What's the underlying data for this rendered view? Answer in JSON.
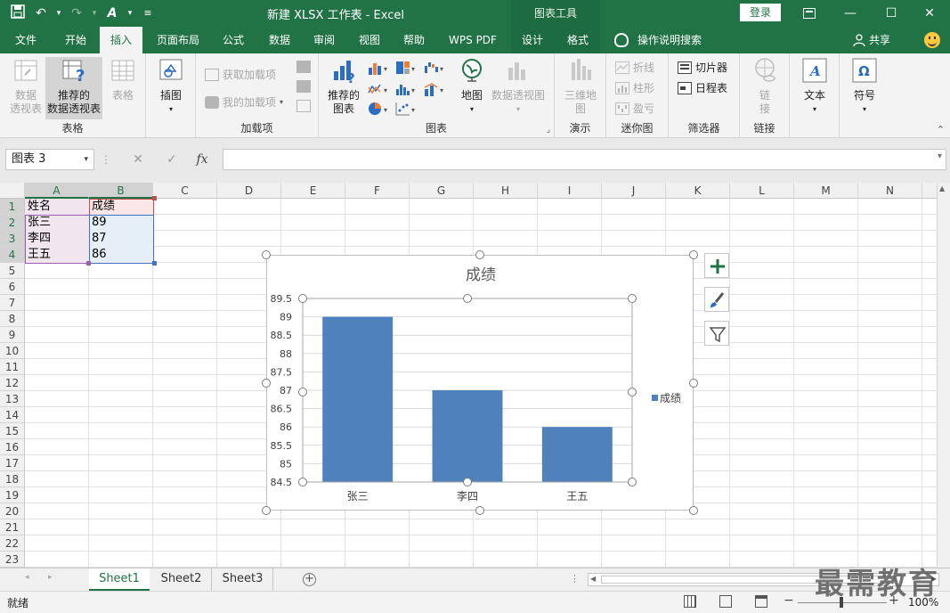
{
  "titlebar": {
    "title": "新建 XLSX 工作表  -  Excel",
    "context_label": "图表工具",
    "login": "登录"
  },
  "tabs": [
    {
      "label": "文件",
      "active": false
    },
    {
      "label": "开始",
      "active": false
    },
    {
      "label": "插入",
      "active": true
    },
    {
      "label": "页面布局",
      "active": false
    },
    {
      "label": "公式",
      "active": false
    },
    {
      "label": "数据",
      "active": false
    },
    {
      "label": "审阅",
      "active": false
    },
    {
      "label": "视图",
      "active": false
    },
    {
      "label": "帮助",
      "active": false
    },
    {
      "label": "WPS PDF",
      "active": false
    },
    {
      "label": "设计",
      "active": false
    },
    {
      "label": "格式",
      "active": false
    }
  ],
  "tell_me": "操作说明搜索",
  "share": "共享",
  "ribbon": {
    "tables": {
      "label": "表格",
      "pivot": "数据\n透视表",
      "recommended_pivot": "推荐的\n数据透视表",
      "table": "表格"
    },
    "illustrations": {
      "insert_picture": "插图"
    },
    "addins": {
      "label": "加载项",
      "get": "获取加载项",
      "my": "我的加载项"
    },
    "charts": {
      "label": "图表",
      "recommended": "推荐的\n图表",
      "map": "地图",
      "pivot_chart": "数据透视图"
    },
    "tours": {
      "label": "演示",
      "map3d": "三维地\n图"
    },
    "sparklines": {
      "label": "迷你图",
      "line": "折线",
      "column": "柱形",
      "winloss": "盈亏"
    },
    "filters": {
      "label": "筛选器",
      "slicer": "切片器",
      "timeline": "日程表"
    },
    "links": {
      "label": "链接",
      "link": "链\n接"
    },
    "text": {
      "label": "文本"
    },
    "symbols": {
      "label": "符号"
    }
  },
  "formula_bar": {
    "name_box": "图表 3",
    "fx": "fx",
    "value": ""
  },
  "columns": [
    "A",
    "B",
    "C",
    "D",
    "E",
    "F",
    "G",
    "H",
    "I",
    "J",
    "K",
    "L",
    "M",
    "N"
  ],
  "rows": [
    "1",
    "2",
    "3",
    "4",
    "5",
    "6",
    "7",
    "8",
    "9",
    "10",
    "11",
    "12",
    "13",
    "14",
    "15",
    "16",
    "17",
    "18",
    "19",
    "20",
    "21",
    "22",
    "23"
  ],
  "cells": {
    "A1": "姓名",
    "B1": "成绩",
    "A2": "张三",
    "B2": "89",
    "A3": "李四",
    "B3": "87",
    "A4": "王五",
    "B4": "86"
  },
  "chart_data": {
    "type": "bar",
    "title": "成绩",
    "categories": [
      "张三",
      "李四",
      "王五"
    ],
    "series": [
      {
        "name": "成绩",
        "values": [
          89,
          87,
          86
        ],
        "color": "#4f81bd"
      }
    ],
    "ylim": [
      84.5,
      89.5
    ],
    "yticks": [
      "84.5",
      "85",
      "85.5",
      "86",
      "86.5",
      "87",
      "87.5",
      "88",
      "88.5",
      "89",
      "89.5"
    ],
    "grid": true,
    "legend": "right"
  },
  "sheets": [
    {
      "label": "Sheet1",
      "active": true
    },
    {
      "label": "Sheet2",
      "active": false
    },
    {
      "label": "Sheet3",
      "active": false
    }
  ],
  "status": {
    "ready": "就绪",
    "zoom": "100%"
  },
  "watermark": "最需教育",
  "colors": {
    "accent": "#217346",
    "bar": "#4f81bd"
  }
}
